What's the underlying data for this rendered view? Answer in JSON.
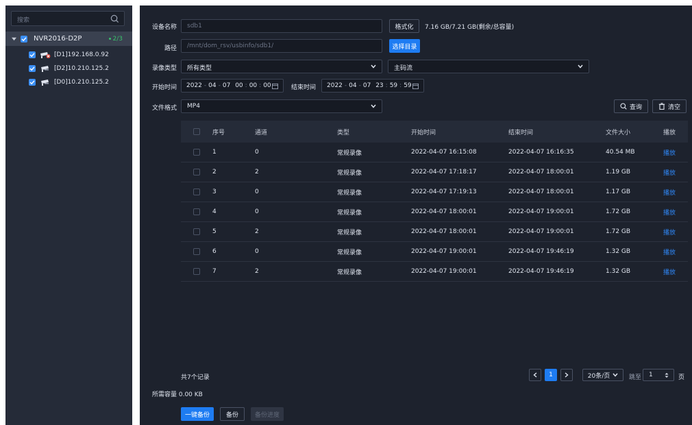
{
  "sidebar": {
    "search_placeholder": "搜索",
    "root": {
      "label": "NVR2016-D2P",
      "count": "2/3"
    },
    "children": [
      {
        "label": "[D1]192.168.0.92",
        "offline": true
      },
      {
        "label": "[D2]10.210.125.2",
        "offline": false
      },
      {
        "label": "[D0]10.210.125.2",
        "offline": false
      }
    ]
  },
  "form": {
    "device_name_label": "设备名称",
    "device_name_value": "sdb1",
    "format_button": "格式化",
    "capacity_text": "7.16 GB/7.21 GB(剩余/总容量)",
    "path_label": "路径",
    "path_value": "/mnt/dom_rsv/usbinfo/sdb1/",
    "select_dir_button": "选择目录",
    "record_type_label": "录像类型",
    "record_type_value": "所有类型",
    "stream_value": "主码流",
    "start_time_label": "开始时间",
    "start_time": {
      "year": "2022",
      "month": "04",
      "day": "07",
      "hour": "00",
      "minute": "00",
      "second": "00"
    },
    "end_time_label": "结束时间",
    "end_time": {
      "year": "2022",
      "month": "04",
      "day": "07",
      "hour": "23",
      "minute": "59",
      "second": "59"
    },
    "file_format_label": "文件格式",
    "file_format_value": "MP4",
    "query_button": "查询",
    "clear_button": "清空"
  },
  "table": {
    "headers": [
      "序号",
      "通道",
      "类型",
      "开始时间",
      "结束时间",
      "文件大小",
      "播放"
    ],
    "rows": [
      {
        "no": "1",
        "channel": "0",
        "type": "常规录像",
        "start": "2022-04-07 16:15:08",
        "end": "2022-04-07 16:16:35",
        "size": "40.54 MB",
        "play": "播放"
      },
      {
        "no": "2",
        "channel": "2",
        "type": "常规录像",
        "start": "2022-04-07 17:18:17",
        "end": "2022-04-07 18:00:01",
        "size": "1.19 GB",
        "play": "播放"
      },
      {
        "no": "3",
        "channel": "0",
        "type": "常规录像",
        "start": "2022-04-07 17:19:13",
        "end": "2022-04-07 18:00:01",
        "size": "1.17 GB",
        "play": "播放"
      },
      {
        "no": "4",
        "channel": "0",
        "type": "常规录像",
        "start": "2022-04-07 18:00:01",
        "end": "2022-04-07 19:00:01",
        "size": "1.72 GB",
        "play": "播放"
      },
      {
        "no": "5",
        "channel": "2",
        "type": "常规录像",
        "start": "2022-04-07 18:00:01",
        "end": "2022-04-07 19:00:01",
        "size": "1.72 GB",
        "play": "播放"
      },
      {
        "no": "6",
        "channel": "0",
        "type": "常规录像",
        "start": "2022-04-07 19:00:01",
        "end": "2022-04-07 19:46:19",
        "size": "1.32 GB",
        "play": "播放"
      },
      {
        "no": "7",
        "channel": "2",
        "type": "常规录像",
        "start": "2022-04-07 19:00:01",
        "end": "2022-04-07 19:46:19",
        "size": "1.32 GB",
        "play": "播放"
      }
    ]
  },
  "footer": {
    "total_records": "共7个记录",
    "current_page": "1",
    "page_size": "20条/页",
    "goto_label": "跳至",
    "goto_value": "1",
    "page_unit": "页",
    "required_capacity": "所需容量 0.00 KB",
    "one_click_backup": "一键备份",
    "backup": "备份",
    "backup_progress": "备份进度"
  },
  "colors": {
    "accent": "#1e7cf2",
    "online": "#39c16b",
    "background": "#1d222d",
    "sidebar": "#252b38"
  }
}
